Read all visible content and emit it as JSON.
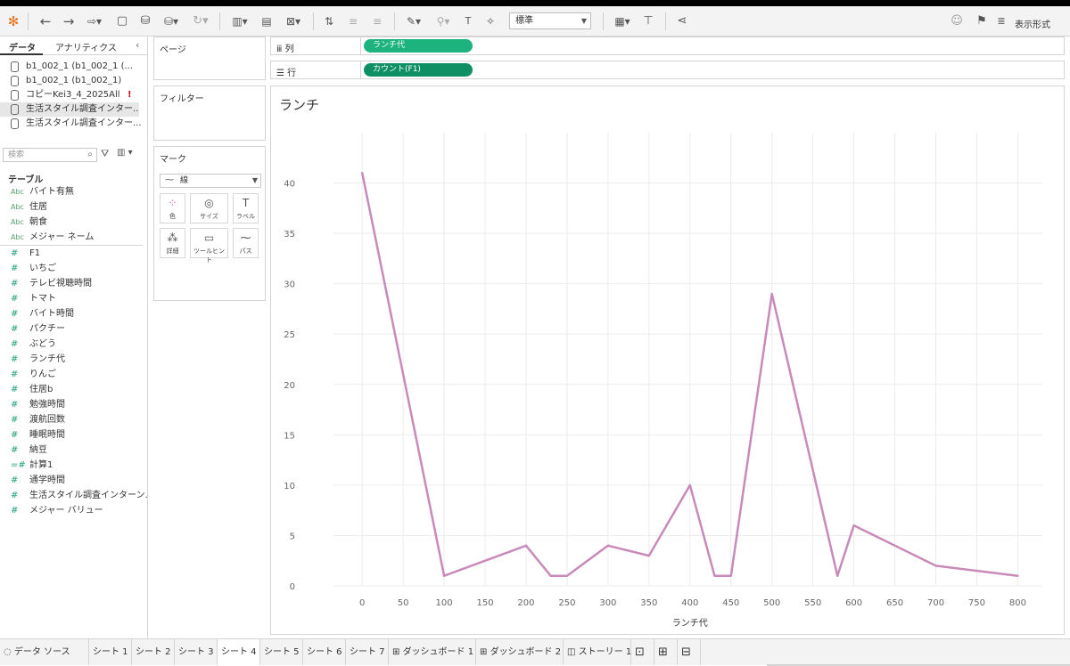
{
  "toolbar": {
    "mark_size_select": "標準",
    "show_me_label": "表示形式",
    "icons": [
      "tableau-logo-icon",
      "undo-icon",
      "redo-icon",
      "redo-dropdown-icon",
      "save-icon",
      "new-datasource-icon",
      "pause-updates-icon",
      "refresh-icon",
      "new-worksheet-icon",
      "duplicate-sheet-icon",
      "clear-sheet-icon",
      "swap-rows-columns-icon",
      "sort-ascending-icon",
      "sort-descending-icon",
      "highlight-icon",
      "group-icon",
      "show-labels-icon",
      "pin-icon",
      "fit-icon",
      "presentation-icon",
      "share-icon",
      "ai-icon",
      "tooltip-icon",
      "show-me-icon"
    ]
  },
  "left_pane": {
    "tabs": [
      "データ",
      "アナリティクス"
    ],
    "datasources": [
      {
        "label": "b1_002_1 (b1_002_1 (...",
        "selected": false,
        "warn": false
      },
      {
        "label": "b1_002_1 (b1_002_1)",
        "selected": false,
        "warn": false
      },
      {
        "label": "コピーKei3_4_2025All",
        "selected": false,
        "warn": true
      },
      {
        "label": "生活スタイル調査インター...",
        "selected": true,
        "warn": false
      },
      {
        "label": "生活スタイル調査インター...",
        "selected": false,
        "warn": false
      }
    ],
    "search_placeholder": "検索",
    "tables_heading": "テーブル",
    "dimensions": [
      {
        "type": "Abc",
        "label": "バイト有無"
      },
      {
        "type": "Abc",
        "label": "住居"
      },
      {
        "type": "Abc",
        "label": "朝食"
      },
      {
        "type": "Abc",
        "label": "メジャー ネーム"
      }
    ],
    "measures": [
      {
        "type": "#",
        "label": "F1"
      },
      {
        "type": "#",
        "label": "いちご"
      },
      {
        "type": "#",
        "label": "テレビ視聴時間"
      },
      {
        "type": "#",
        "label": "トマト"
      },
      {
        "type": "#",
        "label": "バイト時間"
      },
      {
        "type": "#",
        "label": "パクチー"
      },
      {
        "type": "#",
        "label": "ぶどう"
      },
      {
        "type": "#",
        "label": "ランチ代"
      },
      {
        "type": "#",
        "label": "りんご"
      },
      {
        "type": "#",
        "label": "住居b"
      },
      {
        "type": "#",
        "label": "勉強時間"
      },
      {
        "type": "#",
        "label": "渡航回数"
      },
      {
        "type": "#",
        "label": "睡眠時間"
      },
      {
        "type": "#",
        "label": "納豆"
      },
      {
        "type": "=#",
        "label": "計算1"
      },
      {
        "type": "#",
        "label": "通学時間"
      },
      {
        "type": "#",
        "label": "生活スタイル調査インターン..."
      },
      {
        "type": "#",
        "label": "メジャー バリュー"
      }
    ]
  },
  "cards": {
    "pages": "ページ",
    "filters": "フィルター",
    "marks": "マーク",
    "mark_type": "線",
    "mark_buttons": [
      {
        "icon": "color-icon",
        "label": "色"
      },
      {
        "icon": "size-icon",
        "label": "サイズ"
      },
      {
        "icon": "label-icon",
        "label": "ラベル"
      },
      {
        "icon": "detail-icon",
        "label": "詳細"
      },
      {
        "icon": "tooltip-icon",
        "label": "ツールヒント"
      },
      {
        "icon": "path-icon",
        "label": "パス"
      }
    ]
  },
  "shelves": {
    "columns_label": "列",
    "columns_pill": "ランチ代",
    "rows_label": "行",
    "rows_pill": "カウント(F1)"
  },
  "viz": {
    "title": "ランチ"
  },
  "chart_data": {
    "type": "line",
    "title": "ランチ",
    "xlabel": "ランチ代",
    "ylabel": "",
    "x_ticks": [
      0,
      50,
      100,
      150,
      200,
      250,
      300,
      350,
      400,
      450,
      500,
      550,
      600,
      650,
      700,
      750,
      800
    ],
    "y_ticks": [
      0,
      5,
      10,
      15,
      20,
      25,
      30,
      35,
      40
    ],
    "xlim": [
      -35,
      830
    ],
    "ylim": [
      0,
      45
    ],
    "grid": true,
    "color": "#c98aba",
    "series": [
      {
        "x": [
          0,
          100,
          200,
          230,
          250,
          300,
          350,
          400,
          430,
          450,
          500,
          580,
          600,
          700,
          800
        ],
        "y": [
          41,
          1,
          4,
          1,
          1,
          4,
          3,
          10,
          1,
          1,
          29,
          1,
          6,
          2,
          1
        ]
      }
    ]
  },
  "bottom_tabs": [
    {
      "label": "データ ソース",
      "icon": "datasource-icon",
      "active": false
    },
    {
      "label": "シート 1",
      "active": false
    },
    {
      "label": "シート 2",
      "active": false
    },
    {
      "label": "シート 3",
      "active": false
    },
    {
      "label": "シート 4",
      "active": true
    },
    {
      "label": "シート 5",
      "active": false
    },
    {
      "label": "シート 6",
      "active": false
    },
    {
      "label": "シート 7",
      "active": false
    },
    {
      "label": "ダッシュボード 1",
      "icon": "dashboard-icon",
      "active": false
    },
    {
      "label": "ダッシュボード 2",
      "icon": "dashboard-icon",
      "active": false
    },
    {
      "label": "ストーリー 1",
      "icon": "story-icon",
      "active": false
    }
  ]
}
